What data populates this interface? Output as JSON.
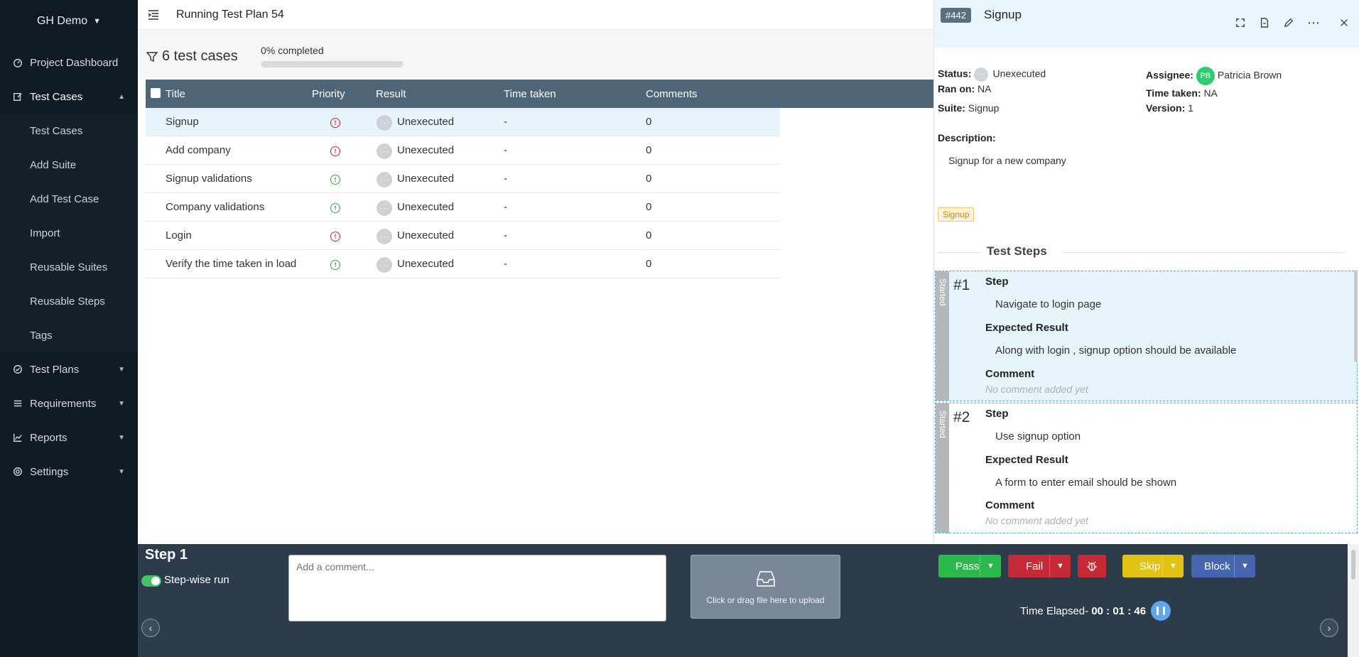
{
  "sidebar": {
    "org_name": "GH Demo",
    "items": [
      {
        "label": "Project Dashboard",
        "icon": "dashboard-icon"
      },
      {
        "label": "Test Cases",
        "icon": "edit-icon",
        "expanded": true
      },
      {
        "label": "Test Plans",
        "icon": "check-circle-icon"
      },
      {
        "label": "Requirements",
        "icon": "list-icon"
      },
      {
        "label": "Reports",
        "icon": "chart-icon"
      },
      {
        "label": "Settings",
        "icon": "gear-icon"
      }
    ],
    "sub_items": [
      "Test Cases",
      "Add Suite",
      "Add Test Case",
      "Import",
      "Reusable Suites",
      "Reusable Steps",
      "Tags"
    ]
  },
  "header": {
    "title": "Running Test Plan 54"
  },
  "summary": {
    "case_count": "6 test cases",
    "progress_label": "0% completed",
    "progress": 0
  },
  "table": {
    "columns": [
      "Title",
      "Priority",
      "Result",
      "Time taken",
      "Comments"
    ],
    "rows": [
      {
        "title": "Signup",
        "priority": "high",
        "result": "Unexecuted",
        "time": "-",
        "comments": "0"
      },
      {
        "title": "Add company",
        "priority": "high",
        "result": "Unexecuted",
        "time": "-",
        "comments": "0"
      },
      {
        "title": "Signup validations",
        "priority": "low",
        "result": "Unexecuted",
        "time": "-",
        "comments": "0"
      },
      {
        "title": "Company validations",
        "priority": "low",
        "result": "Unexecuted",
        "time": "-",
        "comments": "0"
      },
      {
        "title": "Login",
        "priority": "high",
        "result": "Unexecuted",
        "time": "-",
        "comments": "0"
      },
      {
        "title": "Verify the time taken in load",
        "priority": "low",
        "result": "Unexecuted",
        "time": "-",
        "comments": "0"
      }
    ]
  },
  "panel": {
    "case_id": "#442",
    "title": "Signup",
    "status_label": "Status:",
    "status": "Unexecuted",
    "ran_on_label": "Ran on:",
    "ran_on": "NA",
    "suite_label": "Suite:",
    "suite": "Signup",
    "assignee_label": "Assignee:",
    "assignee_initials": "PB",
    "assignee": "Patricia Brown",
    "time_taken_label": "Time taken:",
    "time_taken": "NA",
    "version_label": "Version:",
    "version": "1",
    "description_label": "Description:",
    "description": "Signup for a new company",
    "tag": "Signup",
    "steps_heading": "Test Steps",
    "step_labels": {
      "step": "Step",
      "expected": "Expected Result",
      "comment": "Comment"
    },
    "steps": [
      {
        "num": "#1",
        "state": "Started",
        "step": "Navigate to login page",
        "expected": "Along with login , signup option should be available",
        "comment": "No comment added yet"
      },
      {
        "num": "#2",
        "state": "Started",
        "step": "Use signup option",
        "expected": "A form to enter email should be shown",
        "comment": "No comment added yet"
      }
    ]
  },
  "bottom": {
    "step_label": "Step 1",
    "stepwise_label": "Step-wise run",
    "comment_placeholder": "Add a comment...",
    "upload_text": "Click or drag file here to upload",
    "buttons": {
      "pass": "Pass",
      "fail": "Fail",
      "skip": "Skip",
      "block": "Block"
    },
    "timer_label": "Time Elapsed-",
    "timer_value": "00 : 01 : 46"
  },
  "colors": {
    "pass": "#2db84d",
    "fail": "#c62a36",
    "bug": "#c62a36",
    "skip": "#e2c213",
    "block": "#4665b0",
    "sidebar": "#0f1a24",
    "bottom": "#2d3c4b"
  }
}
